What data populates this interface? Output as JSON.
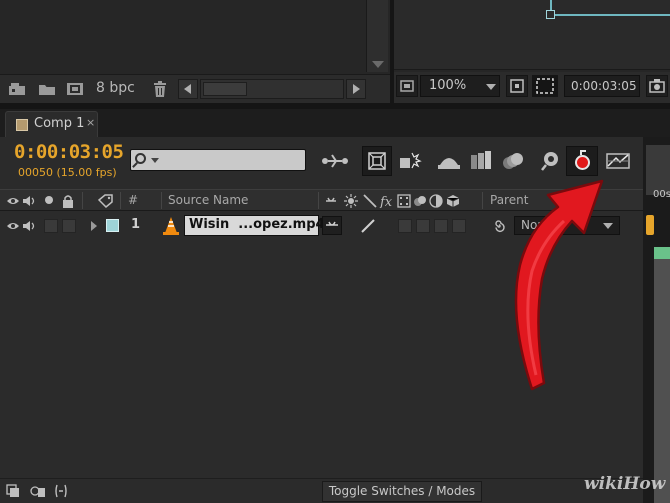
{
  "project_panel": {
    "bit_depth_label": "8 bpc"
  },
  "viewer_panel": {
    "zoom_value": "100%",
    "timecode": "0:00:03:05"
  },
  "timeline": {
    "tab_label": "Comp 1",
    "tab_close": "×",
    "current_time": "0:00:03:05",
    "frame_info": "00050 (15.00 fps)",
    "ruler_label": "00s",
    "columns": {
      "hash": "#",
      "source_name": "Source Name",
      "parent": "Parent"
    },
    "layer": {
      "number": "1",
      "name": "Wisin  ...opez.mp4",
      "parent_value": "None"
    },
    "toggle_label": "Toggle Switches / Modes"
  },
  "watermark": "wikiHow",
  "colors": {
    "timecode": "#e6a52b",
    "motion_blur_fill": "#e11a1a",
    "arrow": "#e1181f",
    "label_swatch": "#b49a6e"
  },
  "icons": [
    "new-folder-icon",
    "folder-icon",
    "composition-icon",
    "trash-icon",
    "grid-icon",
    "snapshot-icon",
    "search-icon",
    "comp-flowchart-icon",
    "draft-3d-icon",
    "hide-shy-icon",
    "frame-blending-icon",
    "motion-blur-icon",
    "graph-editor-icon",
    "eye-icon",
    "audio-icon",
    "lock-icon",
    "label-icon",
    "fx-icon",
    "pickwhip-icon",
    "vlc-cone-icon"
  ]
}
